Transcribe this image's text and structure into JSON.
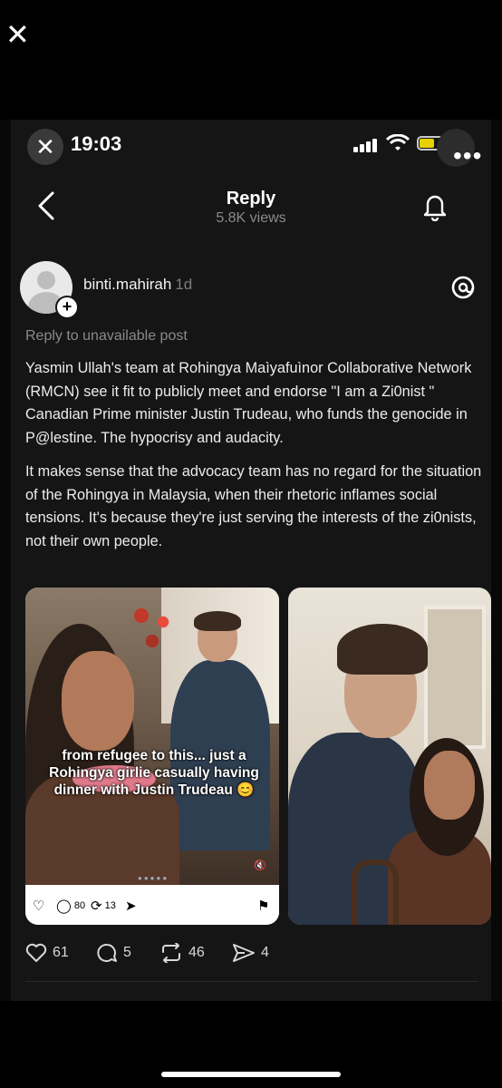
{
  "status_bar": {
    "time": "19:03"
  },
  "header": {
    "title": "Reply",
    "views": "5.8K views"
  },
  "post": {
    "username": "binti.mahirah",
    "time_ago": "1d",
    "reply_context": "Reply to unavailable post",
    "paragraphs": [
      "Yasmin Ullah's team at Rohingya Maìyafuìnor Collaborative Network (RMCN) see it fit to publicly meet and endorse \"I am a Zi0nist \" Canadian Prime minister Justin Trudeau, who funds the genocide in P@lestine. The hypocrisy and audacity.",
      "It makes sense that the advocacy team has no regard for the situation of the Rohingya in Malaysia, when their rhetoric inflames social tensions. It's because they're just serving the interests of the zi0nists, not their own people."
    ],
    "media": [
      {
        "caption": "from refugee to this... just a Rohingya girlie casually having dinner with Justin Trudeau 😊",
        "mini_actions": {
          "comments": "80",
          "reposts": "13"
        }
      }
    ],
    "actions": {
      "likes": "61",
      "comments": "5",
      "reposts": "46",
      "shares": "4"
    }
  },
  "icons": [
    "close-icon",
    "more-icon",
    "back-icon",
    "bell-icon",
    "threads-logo-icon",
    "heart-icon",
    "comment-icon",
    "repost-icon",
    "share-icon",
    "bookmark-icon"
  ]
}
